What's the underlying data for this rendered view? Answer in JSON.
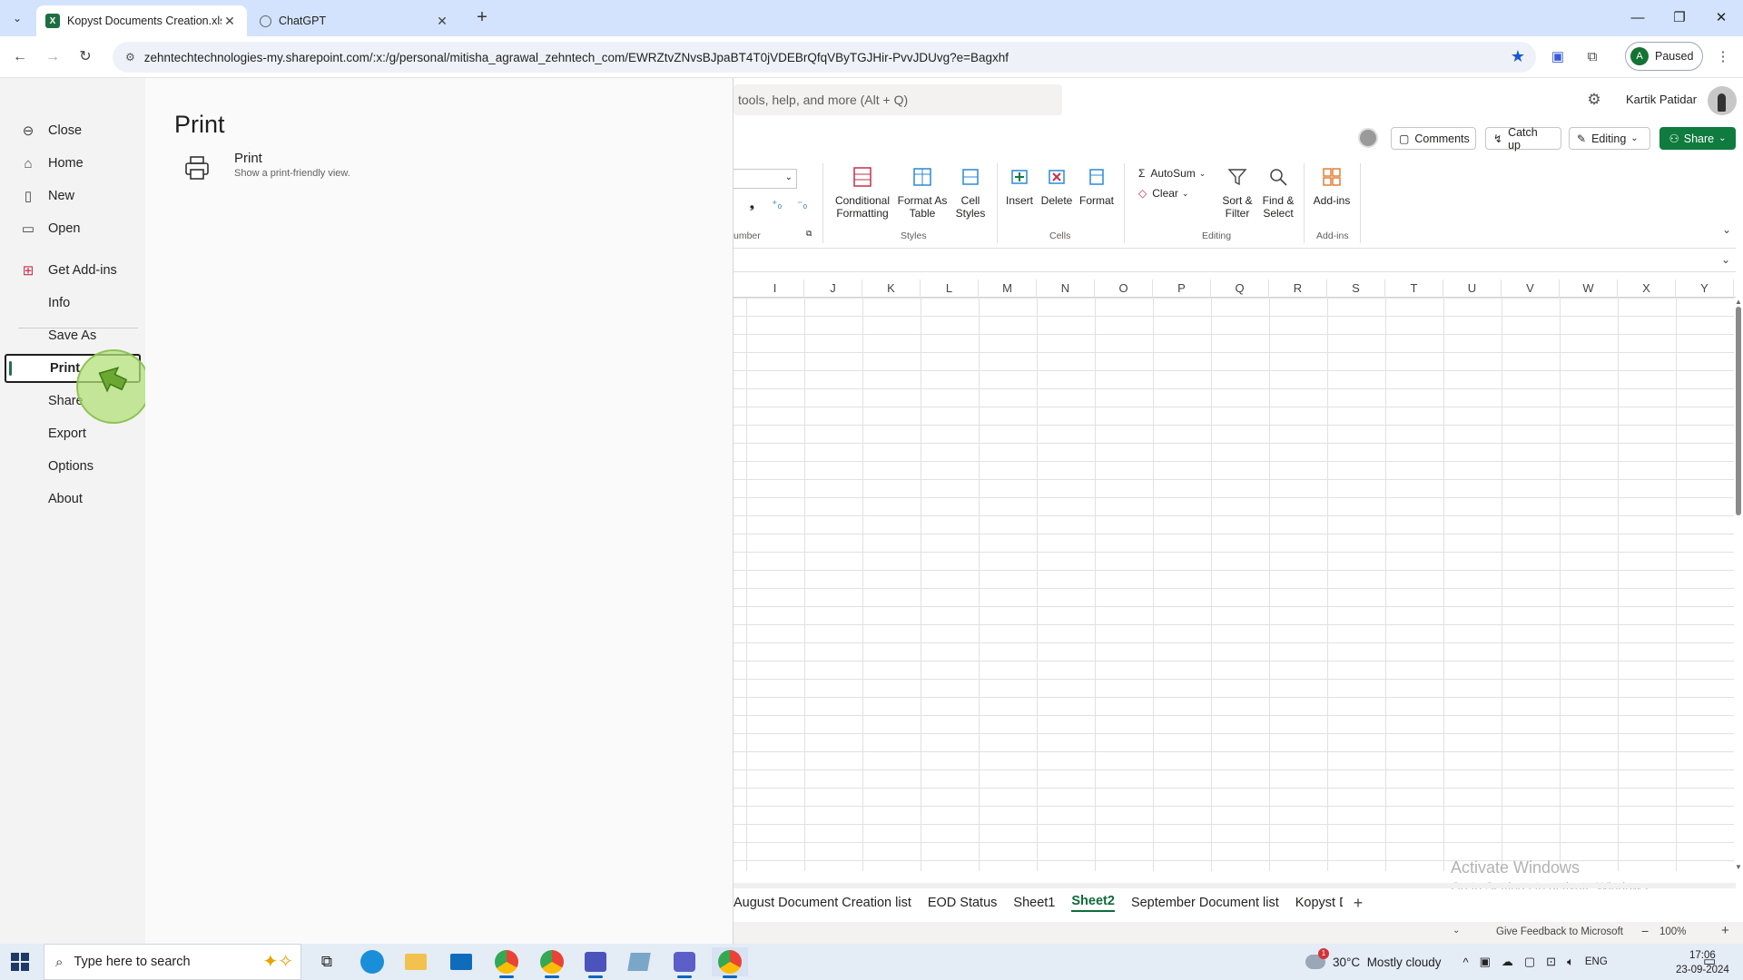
{
  "browser": {
    "tabs": [
      {
        "title": "Kopyst Documents Creation.xlsx",
        "active": true
      },
      {
        "title": "ChatGPT",
        "active": false
      }
    ],
    "url": "zehntechtechnologies-my.sharepoint.com/:x:/g/personal/mitisha_agrawal_zehntech_com/EWRZtvZNvsBJpaBT4T0jVDEBrQfqVByTGJHir-PvvJDUvg?e=Bagxhf",
    "profile": {
      "initial": "A",
      "label": "Paused"
    }
  },
  "backstage": {
    "nav": [
      {
        "label": "Close",
        "icon": "back-arrow-icon"
      },
      {
        "label": "Home",
        "icon": "home-icon"
      },
      {
        "label": "New",
        "icon": "new-document-icon"
      },
      {
        "label": "Open",
        "icon": "open-folder-icon"
      },
      {
        "label": "Get Add-ins",
        "icon": "addins-icon"
      },
      {
        "label": "Info"
      },
      {
        "label": "Save As"
      },
      {
        "label": "Print",
        "selected": true
      },
      {
        "label": "Share"
      },
      {
        "label": "Export"
      },
      {
        "label": "Options"
      },
      {
        "label": "About"
      }
    ],
    "print": {
      "heading": "Print",
      "option_title": "Print",
      "option_subtitle": "Show a print-friendly view."
    }
  },
  "excel": {
    "search_placeholder": "tools, help, and more (Alt + Q)",
    "user_name": "Kartik Patidar",
    "buttons": {
      "comments": "Comments",
      "catch_up": "Catch up",
      "editing": "Editing",
      "share": "Share"
    },
    "ribbon": {
      "number_group_label": "umber",
      "conditional_formatting": "Conditional Formatting",
      "format_as_table": "Format As Table",
      "cell_styles": "Cell Styles",
      "styles_label": "Styles",
      "insert": "Insert",
      "delete": "Delete",
      "format": "Format",
      "cells_label": "Cells",
      "autosum": "AutoSum",
      "clear": "Clear",
      "sort_filter": "Sort & Filter",
      "find_select": "Find & Select",
      "editing_label": "Editing",
      "addins": "Add-ins",
      "addins_label": "Add-ins"
    },
    "columns": [
      "I",
      "J",
      "K",
      "L",
      "M",
      "N",
      "O",
      "P",
      "Q",
      "R",
      "S",
      "T",
      "U",
      "V",
      "W",
      "X",
      "Y"
    ],
    "sheet_tabs": [
      {
        "label": "August Document Creation list"
      },
      {
        "label": "EOD Status"
      },
      {
        "label": "Sheet1"
      },
      {
        "label": "Sheet2",
        "active": true
      },
      {
        "label": "September Document list"
      },
      {
        "label": "Kopyst D"
      }
    ],
    "status": {
      "feedback": "Give Feedback to Microsoft",
      "zoom": "100%"
    },
    "watermark": {
      "line1": "Activate Windows",
      "line2": "Go to Settings to activate Windows."
    }
  },
  "taskbar": {
    "search_placeholder": "Type here to search",
    "weather": {
      "temp": "30°C",
      "desc": "Mostly cloudy",
      "badge": "1"
    },
    "lang": "ENG",
    "time": "17:06",
    "date": "23-09-2024"
  },
  "colors": {
    "excel_green": "#0f7b3f",
    "tabstrip": "#d3e3fd",
    "taskbar": "#e4ecf6"
  }
}
